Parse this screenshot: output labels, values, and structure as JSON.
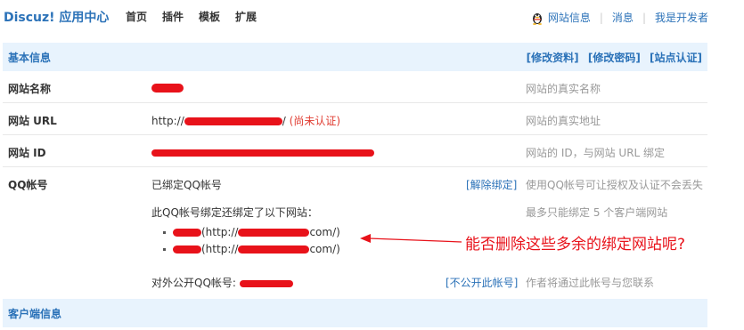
{
  "header": {
    "logo": "Discuz! 应用中心",
    "nav": [
      "首页",
      "插件",
      "模板",
      "扩展"
    ],
    "right": [
      "网站信息",
      "消息",
      "我是开发者"
    ]
  },
  "basic": {
    "title": "基本信息",
    "links": [
      "[修改资料]",
      "[修改密码]",
      "[站点认证]"
    ]
  },
  "rows": {
    "name": {
      "label": "网站名称",
      "hint": "网站的真实名称"
    },
    "url": {
      "label": "网站 URL",
      "prefix": "http://",
      "suffix": "/",
      "status": "(尚未认证)",
      "hint": "网站的真实地址"
    },
    "id": {
      "label": "网站 ID",
      "hint": "网站的 ID，与网站 URL 绑定"
    },
    "qq": {
      "label": "QQ帐号",
      "value": "已绑定QQ帐号",
      "action": "[解除绑定]",
      "hint": "使用QQ帐号可让授权及认证不会丢失"
    },
    "bound": {
      "intro": "此QQ帐号绑定还绑定了以下网站：",
      "hint": "最多只能绑定 5 个客户端网站",
      "sites": [
        {
          "prefix": "(http://",
          "suffix": "com/)"
        },
        {
          "prefix": "(http://",
          "suffix": "com/)"
        }
      ]
    },
    "public": {
      "value": "对外公开QQ帐号:",
      "action": "[不公开此帐号]",
      "hint": "作者将通过此帐号与您联系"
    }
  },
  "client": {
    "title": "客户端信息"
  },
  "annotation": "能否删除这些多余的绑定网站呢?",
  "colors": {
    "accent": "#2b72b8",
    "header_bg": "#e8f3fd",
    "redact": "#e8121a"
  }
}
